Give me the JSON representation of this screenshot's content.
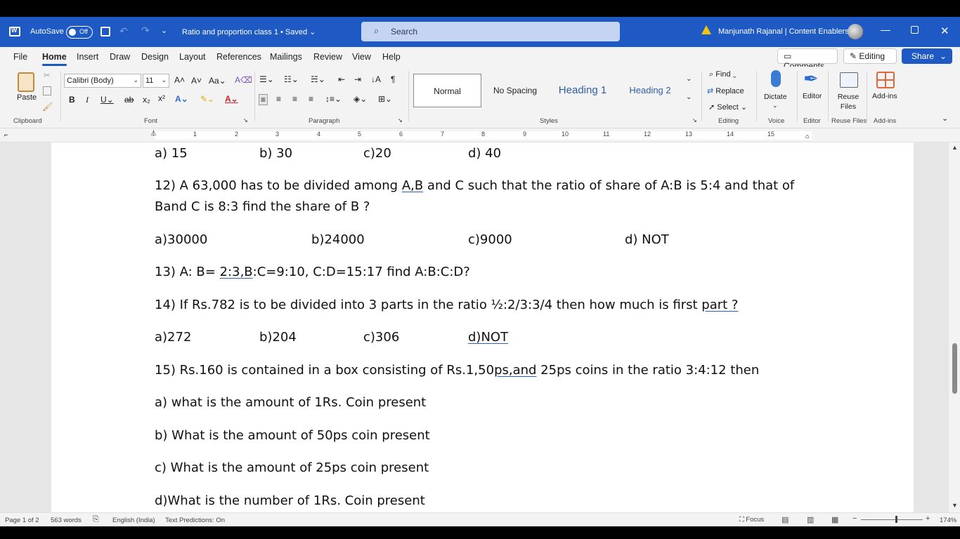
{
  "titlebar": {
    "autosave_label": "AutoSave",
    "autosave_state": "Off",
    "doc_title": "Ratio and proportion class 1 • Saved ⌄",
    "search_placeholder": "Search",
    "user_name": "Manjunath Rajanal | Content Enablers"
  },
  "menu": {
    "tabs": [
      "File",
      "Home",
      "Insert",
      "Draw",
      "Design",
      "Layout",
      "References",
      "Mailings",
      "Review",
      "View",
      "Help"
    ],
    "active": "Home",
    "comments": "Comments",
    "editing": "Editing",
    "share": "Share"
  },
  "ribbon": {
    "paste": "Paste",
    "font_name": "Calibri (Body)",
    "font_size": "11",
    "styles": {
      "normal": "Normal",
      "no_spacing": "No Spacing",
      "heading1": "Heading 1",
      "heading2": "Heading 2"
    },
    "find": "Find",
    "replace": "Replace",
    "select": "Select",
    "dictate": "Dictate",
    "editor": "Editor",
    "reuse_files": "Reuse Files",
    "addins": "Add-ins",
    "groups": {
      "clipboard": "Clipboard",
      "font": "Font",
      "paragraph": "Paragraph",
      "styles": "Styles",
      "editing": "Editing",
      "voice": "Voice",
      "editor": "Editor",
      "reuse_files": "Reuse Files",
      "addins": "Add-ins"
    }
  },
  "ruler": {
    "numbers": [
      "1",
      "2",
      "3",
      "4",
      "5",
      "6",
      "7",
      "8",
      "9",
      "10",
      "11",
      "12",
      "13",
      "14",
      "15"
    ]
  },
  "document": {
    "q11_options": [
      "a) 15",
      "b) 30",
      "c)20",
      "d) 40"
    ],
    "q12_line1_a": "12) A 63,000 has to be divided among ",
    "q12_line1_u": "A,B",
    "q12_line1_b": " and C such that the ratio of share of A:B is 5:4 and that of",
    "q12_line2": "Band C is 8:3 find the share of B ?",
    "q12_options": [
      "a)30000",
      "b)24000",
      "c)9000",
      "d) NOT"
    ],
    "q13_a": "13) A: B= ",
    "q13_u": "2:3,B",
    "q13_b": ":C=9:10, C:D=15:17 find  A:B:C:D?",
    "q14_a": "14) If Rs.782 is to be divided into 3 parts in the ratio ½:2/3:3/4 then how much is first ",
    "q14_u": "part ?",
    "q14_options": [
      "a)272",
      "b)204",
      "c)306",
      "d)NOT"
    ],
    "q15_a": "15) Rs.160 is contained in a box consisting of Rs.1,50",
    "q15_u": "ps,and",
    "q15_b": " 25ps coins in the ratio 3:4:12 then",
    "q15_sub": [
      "a) what is the amount of 1Rs. Coin present",
      "b) What is the amount of 50ps coin present",
      "c) What is the amount of 25ps coin present",
      "d)What is the number of 1Rs. Coin present"
    ]
  },
  "status": {
    "page": "Page 1 of 2",
    "words": "563 words",
    "language": "English (India)",
    "predictions": "Text Predictions: On",
    "focus": "Focus",
    "zoom": "174%"
  }
}
